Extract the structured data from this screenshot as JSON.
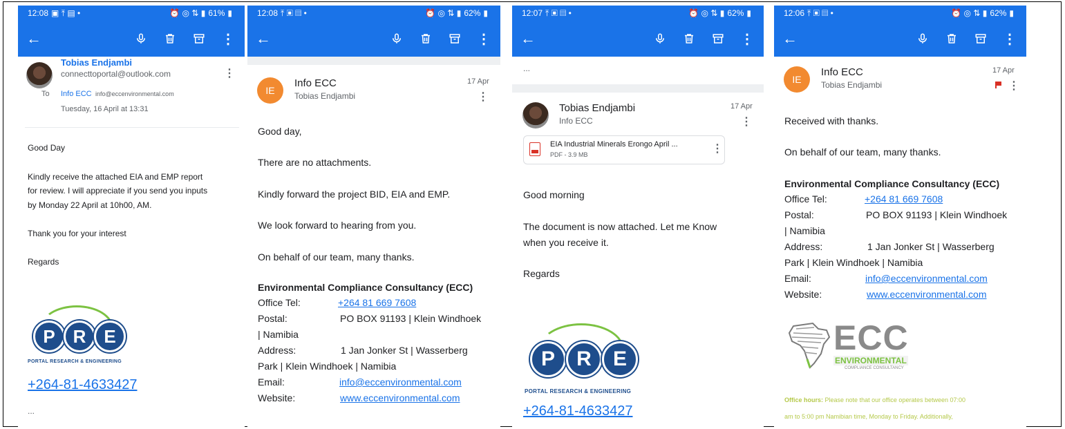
{
  "panels": [
    {
      "status": {
        "time": "12:08",
        "battery": "61%"
      },
      "sender": {
        "name": "Tobias Endjambi",
        "email": "connecttoportal@outlook.com"
      },
      "to": {
        "label": "To",
        "name": "Info ECC",
        "email": "info@eccenvironmental.com",
        "date": "Tuesday, 16 April at 13:31"
      },
      "body": [
        "Good Day",
        "Kindly receive the attached EIA and EMP report",
        "for review. I will appreciate if you send you inputs",
        "by Monday 22 April at 10h00, AM.",
        "Thank you for your interest",
        "Regards"
      ],
      "logo_tagline": "PORTAL RESEARCH & ENGINEERING",
      "phone": "+264-81-4633427",
      "more": "..."
    },
    {
      "status": {
        "time": "12:08",
        "battery": "62%"
      },
      "sender": {
        "initials": "IE",
        "name": "Info ECC",
        "sub": "Tobias Endjambi",
        "date": "17 Apr"
      },
      "body": [
        "Good day,",
        "There are no attachments.",
        "Kindly forward the project BID, EIA and EMP.",
        "We look forward to hearing from you.",
        "On behalf of our team, many thanks."
      ],
      "signature": {
        "title": "Environmental Compliance Consultancy (ECC)",
        "tel_label": "Office Tel:",
        "tel": "+264 81 669 7608",
        "postal_label": "Postal:",
        "postal": "PO BOX 91193 | Klein Windhoek",
        "postal2": "| Namibia",
        "address_label": "Address:",
        "address": "1 Jan Jonker St | Wasserberg",
        "address2": "Park | Klein Windhoek | Namibia",
        "email_label": "Email:",
        "email": "info@eccenvironmental.com",
        "website_label": "Website:",
        "website": "www.eccenvironmental.com"
      }
    },
    {
      "status": {
        "time": "12:07",
        "battery": "62%"
      },
      "more": "...",
      "sender": {
        "name": "Tobias Endjambi",
        "sub": "Info ECC",
        "date": "17 Apr"
      },
      "attachment": {
        "name": "EIA Industrial Minerals Erongo April ...",
        "meta": "PDF - 3.9 MB"
      },
      "body": [
        "Good morning",
        "The document is now attached. Let me Know",
        "when you receive it.",
        "Regards"
      ],
      "logo_tagline": "PORTAL RESEARCH & ENGINEERING",
      "phone": "+264-81-4633427"
    },
    {
      "status": {
        "time": "12:06",
        "battery": "62%"
      },
      "sender": {
        "initials": "IE",
        "name": "Info ECC",
        "sub": "Tobias Endjambi",
        "date": "17 Apr"
      },
      "body": [
        "Received with thanks.",
        "On behalf of our team, many thanks."
      ],
      "signature": {
        "title": "Environmental Compliance Consultancy (ECC)",
        "tel_label": "Office Tel:",
        "tel": "+264 81 669 7608",
        "postal_label": "Postal:",
        "postal": "PO BOX 91193 | Klein Windhoek",
        "postal2": "| Namibia",
        "address_label": "Address:",
        "address": "1 Jan Jonker St | Wasserberg",
        "address2": "Park | Klein Windhoek | Namibia",
        "email_label": "Email:",
        "email": "info@eccenvironmental.com",
        "website_label": "Website:",
        "website": "www.eccenvironmental.com"
      },
      "ecc_logo": {
        "letters": "ECC",
        "line1": "ENVIRONMENTAL",
        "line2": "COMPLIANCE CONSULTANCY"
      },
      "office_hours": {
        "label": "Office hours:",
        "text": "Please note that our office operates between 07:00",
        "text2": "am to 5:00 pm Namibian time, Monday to Friday. Additionally,"
      }
    }
  ],
  "logo_letters": {
    "p": "P",
    "r": "R",
    "e": "E"
  },
  "colors": {
    "toolbar": "#1a73e8",
    "avatar": "#f28a30",
    "pre_blue": "#1e4d8c",
    "pre_green": "#7cc242",
    "office_hours": "#b5c94a"
  }
}
